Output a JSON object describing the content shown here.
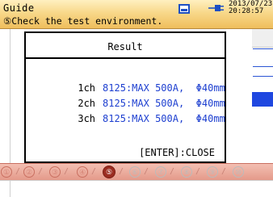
{
  "header": {
    "title": "Guide",
    "step_title": "⑤Check the test environment.",
    "clock_date": "2013/07/23",
    "clock_time": "20:28:57"
  },
  "dialog": {
    "title": "Result",
    "rows": [
      {
        "channel": "1ch",
        "value": "8125:MAX 500A,  Φ40mm"
      },
      {
        "channel": "2ch",
        "value": "8125:MAX 500A,  Φ40mm"
      },
      {
        "channel": "3ch",
        "value": "8125:MAX 500A,  Φ40mm"
      }
    ],
    "close_label": "[ENTER]:CLOSE"
  },
  "stepbar": {
    "steps": [
      "①",
      "②",
      "③",
      "④",
      "⑤",
      "⑥",
      "⑦",
      "⑧",
      "⑨",
      "⑩"
    ],
    "active_index": 4
  },
  "colors": {
    "header_gradient": "#efbe5c",
    "value_text": "#1d3fd0",
    "active_step": "#9b2d21",
    "stepbar": "#e49a8a"
  },
  "icons": [
    "memory-card-icon",
    "power-plug-icon"
  ]
}
